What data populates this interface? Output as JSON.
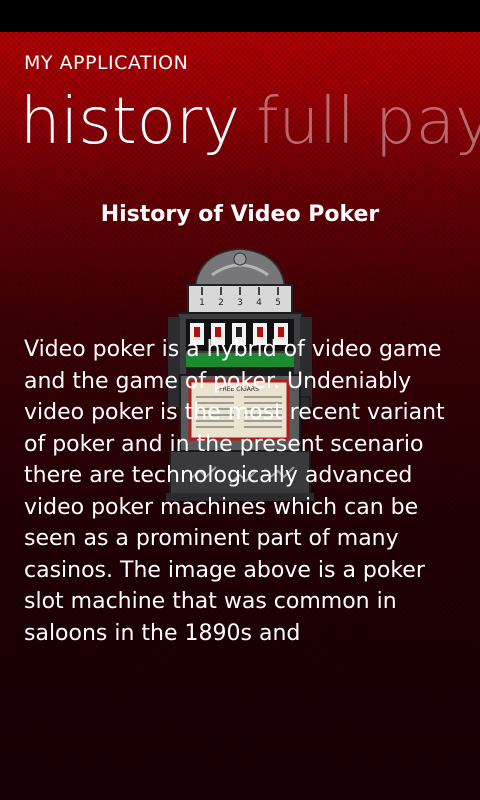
{
  "app": {
    "title": "MY APPLICATION"
  },
  "pivot": {
    "items": [
      {
        "label": "history",
        "active": true
      },
      {
        "label": "full pay",
        "active": false
      }
    ]
  },
  "history": {
    "heading": "History of Video Poker",
    "image": {
      "icon": "poker-slot-machine",
      "reel_labels": [
        "1",
        "2",
        "3",
        "4",
        "5"
      ],
      "sign_text": "FREE CIGARS"
    },
    "body": "Video poker is a hybrid of video game and the game of poker. Undeniably video poker is the most recent variant of poker and in the present scenario there are technologically advanced video poker machines which can be seen as a prominent part of many casinos. The image above is a poker slot machine that was common in saloons in the 1890s and"
  },
  "colors": {
    "accent": "#c10000",
    "background_dark": "#180004",
    "text": "#ffffff"
  }
}
